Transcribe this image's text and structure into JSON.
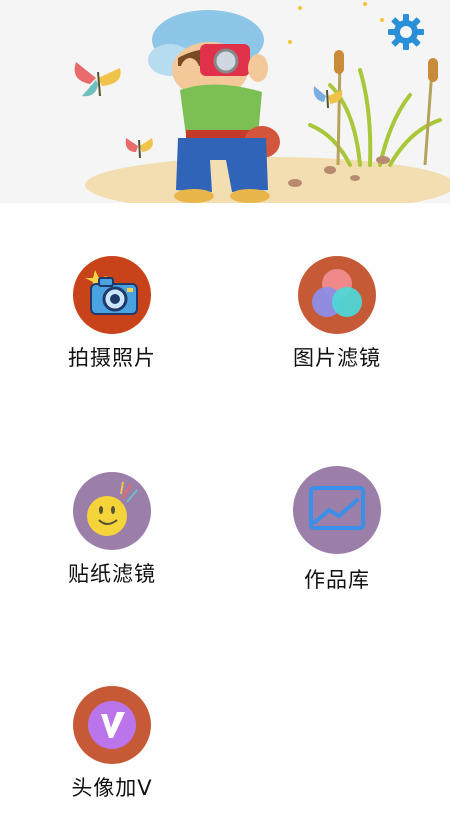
{
  "banner": {
    "illustration": "boy-with-camera-and-butterflies",
    "settings_icon": "gear-icon",
    "colors": {
      "gear": "#2a8fd6"
    }
  },
  "menu": [
    {
      "id": "take-photo",
      "label": "拍摄照片",
      "icon": "camera-icon",
      "bg": "#c8421a"
    },
    {
      "id": "photo-filter",
      "label": "图片滤镜",
      "icon": "color-circles-icon",
      "bg": "#c65a36"
    },
    {
      "id": "sticker-filter",
      "label": "贴纸滤镜",
      "icon": "smiley-icon",
      "bg": "#9b7fa8"
    },
    {
      "id": "gallery",
      "label": "作品库",
      "icon": "image-chart-icon",
      "bg": "#9b7fa8"
    },
    {
      "id": "avatar-v",
      "label": "头像加V",
      "icon": "v-badge-icon",
      "bg": "#c65a36"
    }
  ]
}
